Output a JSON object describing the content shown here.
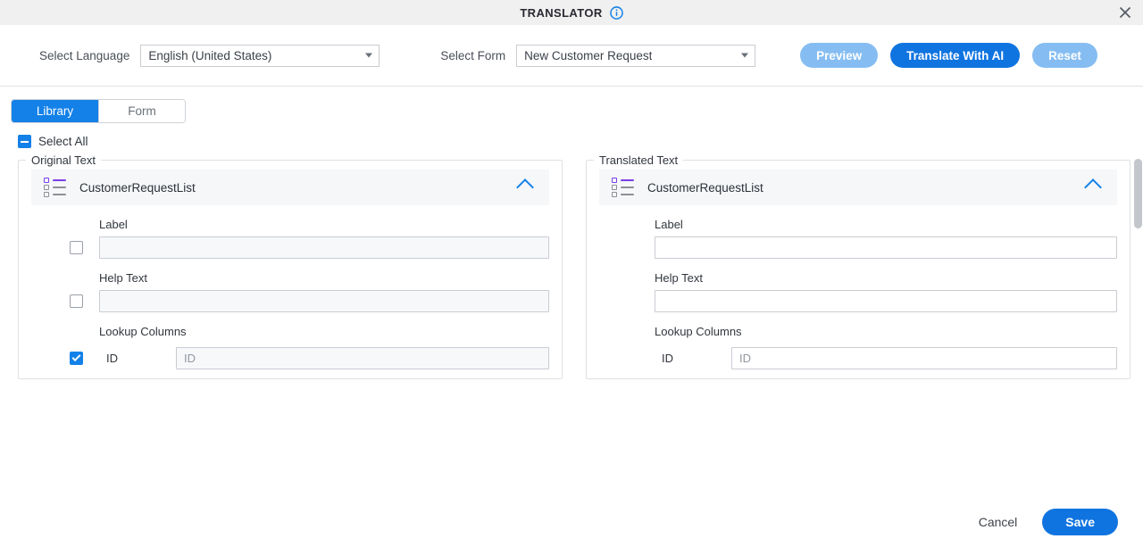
{
  "titlebar": {
    "title": "TRANSLATOR",
    "info_icon": "info-circle-icon",
    "close_icon": "close-icon"
  },
  "toolbar": {
    "language": {
      "label": "Select Language",
      "value": "English (United States)"
    },
    "form": {
      "label": "Select Form",
      "value": "New Customer Request"
    },
    "buttons": {
      "preview": "Preview",
      "translate": "Translate With AI",
      "reset": "Reset"
    },
    "colors": {
      "primary": "#1074e0",
      "disabled": "#85bdf2"
    }
  },
  "tabs": [
    {
      "label": "Library",
      "active": true
    },
    {
      "label": "Form",
      "active": false
    }
  ],
  "select_all": {
    "label": "Select All",
    "state": "indeterminate"
  },
  "panels": {
    "original": {
      "legend": "Original Text",
      "group": {
        "icon": "list-icon",
        "title": "CustomerRequestList",
        "collapse_icon": "chevron-up-icon"
      },
      "fields": [
        {
          "label": "Label",
          "value": "",
          "checked": false
        },
        {
          "label": "Help Text",
          "value": "",
          "checked": false
        }
      ],
      "lookup": {
        "heading": "Lookup Columns",
        "rows": [
          {
            "name": "ID",
            "placeholder": "ID",
            "value": "",
            "checked": true
          }
        ]
      }
    },
    "translated": {
      "legend": "Translated Text",
      "group": {
        "icon": "list-icon",
        "title": "CustomerRequestList",
        "collapse_icon": "chevron-up-icon"
      },
      "fields": [
        {
          "label": "Label",
          "value": ""
        },
        {
          "label": "Help Text",
          "value": ""
        }
      ],
      "lookup": {
        "heading": "Lookup Columns",
        "rows": [
          {
            "name": "ID",
            "placeholder": "ID",
            "value": ""
          }
        ]
      }
    }
  },
  "footer": {
    "cancel": "Cancel",
    "save": "Save"
  }
}
